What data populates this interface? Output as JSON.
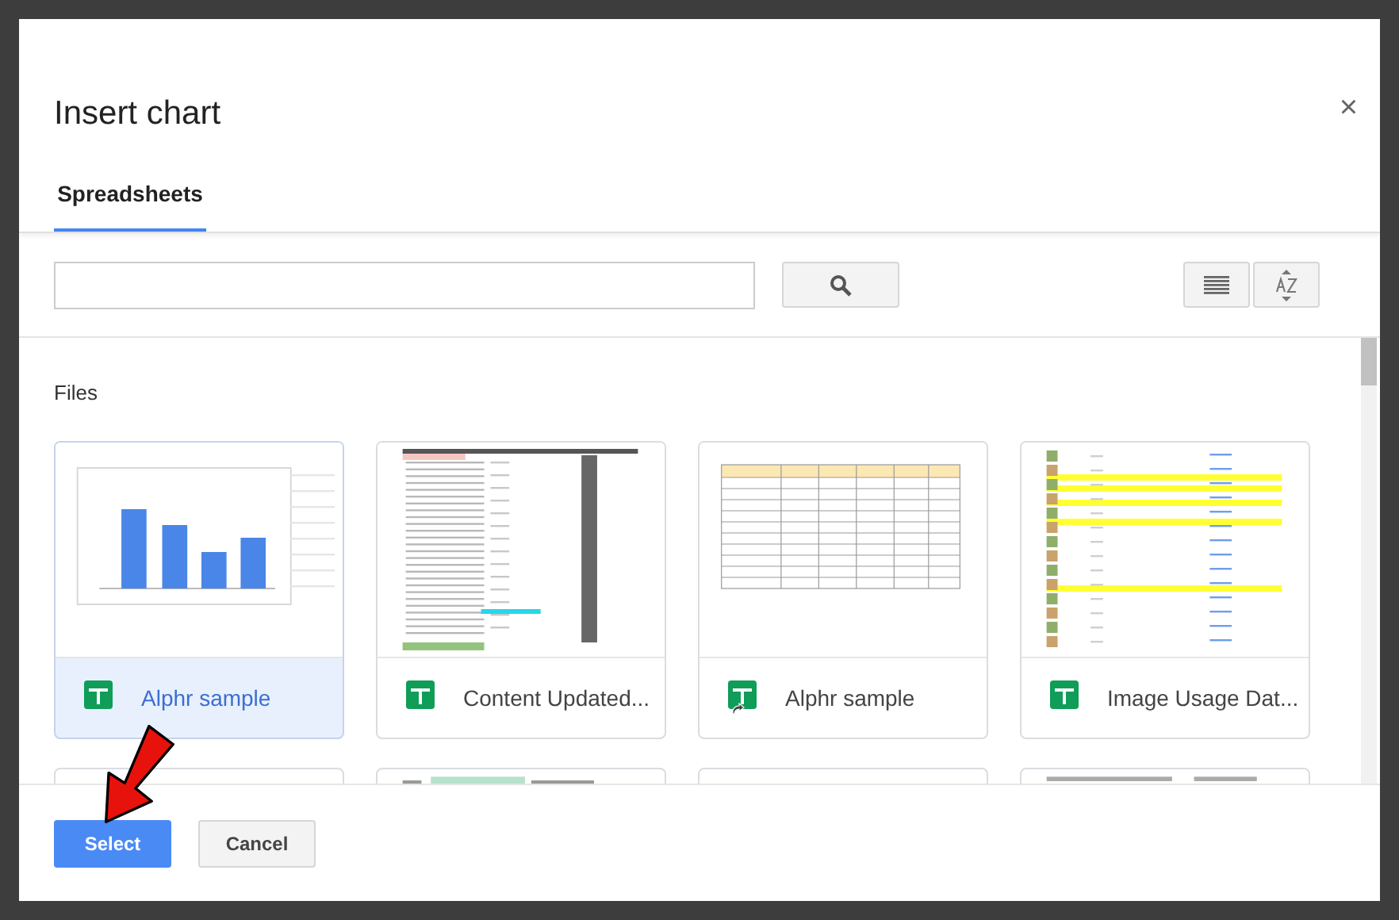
{
  "dialog": {
    "title": "Insert chart",
    "close": "×"
  },
  "tabs": [
    {
      "label": "Spreadsheets",
      "selected": true
    }
  ],
  "toolbar": {
    "view_buttons": [
      {
        "kind": "list"
      },
      {
        "kind": "sort"
      }
    ]
  },
  "section": {
    "title": "Files"
  },
  "files": [
    {
      "name": "Alphr sample",
      "selected": true,
      "shortcut": false,
      "kind": "chart"
    },
    {
      "name": "Content Updated...",
      "selected": false,
      "shortcut": false,
      "kind": "list"
    },
    {
      "name": "Alphr sample",
      "selected": false,
      "shortcut": true,
      "kind": "table"
    },
    {
      "name": "Image Usage Dat...",
      "selected": false,
      "shortcut": false,
      "kind": "images"
    }
  ],
  "partial_files": [
    {
      "kind": "blank"
    },
    {
      "kind": "green"
    },
    {
      "kind": "blank"
    },
    {
      "kind": "rows"
    }
  ],
  "buttons": [
    {
      "label": "Select",
      "kind": "primary"
    },
    {
      "label": "Cancel",
      "kind": "secondary"
    }
  ]
}
